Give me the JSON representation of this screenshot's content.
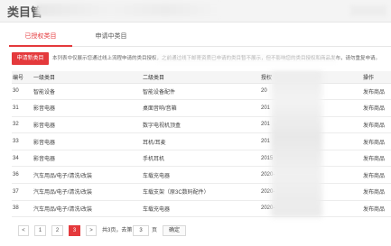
{
  "header": {
    "title": "类目管"
  },
  "tabs": [
    {
      "label": "已授权类目",
      "active": true
    },
    {
      "label": "申请中类目",
      "active": false
    }
  ],
  "notice": {
    "apply_button": "申请新类目",
    "text": "本列表中仅展示您通过线上流程申请的类目授权，之前通过线下邮寄资质已申请的类目暂不展示，但不影响您的类目授权和商品发布，请勿重复申请。"
  },
  "table": {
    "headers": [
      "编号",
      "一级类目",
      "二级类目",
      "授权",
      "操作"
    ],
    "rows": [
      {
        "no": "30",
        "l1": "智能设备",
        "l2": "智能设备配件",
        "time": "20",
        "op": "发布商品"
      },
      {
        "no": "31",
        "l1": "影音电器",
        "l2": "桌面音响/音箱",
        "time": "201",
        "op": "发布商品"
      },
      {
        "no": "32",
        "l1": "影音电器",
        "l2": "数字电视机顶盒",
        "time": "201",
        "op": "发布商品"
      },
      {
        "no": "33",
        "l1": "影音电器",
        "l2": "耳机/耳麦",
        "time": "201",
        "op": "发布商品"
      },
      {
        "no": "34",
        "l1": "影音电器",
        "l2": "手机耳机",
        "time": "2015",
        "op": "发布商品"
      },
      {
        "no": "36",
        "l1": "汽车用品/电子/清洗/改装",
        "l2": "车载充电器",
        "time": "2020-",
        "op": "发布商品"
      },
      {
        "no": "37",
        "l1": "汽车用品/电子/清洗/改装",
        "l2": "车载支架（原3C数码配件）",
        "time": "2020-",
        "op": "发布商品"
      },
      {
        "no": "38",
        "l1": "汽车用品/电子/清洗/改装",
        "l2": "车载充电器",
        "time": "2020-",
        "op": "发布商品"
      }
    ]
  },
  "pager": {
    "prev": "<",
    "pages": [
      "1",
      "2",
      "3"
    ],
    "next": ">",
    "summary": "共3页，去第",
    "input_value": "3",
    "unit": "页",
    "go": "确定"
  },
  "colors": {
    "accent": "#e4393c",
    "link": "#3d7cc9"
  }
}
